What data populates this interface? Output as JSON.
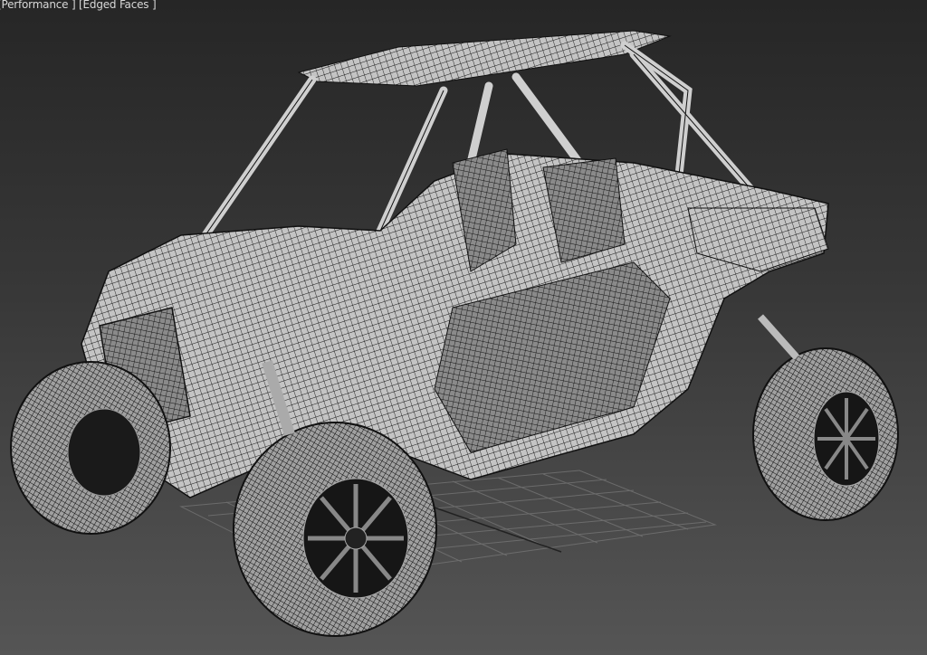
{
  "viewport": {
    "labels": {
      "shading_mode": "[Performance ]",
      "edged_faces": "[Edged Faces ]"
    },
    "colors": {
      "background_top": "#262626",
      "background_bottom": "#555555",
      "wire": "#0a0a0a",
      "surface": "#bdbdbd",
      "grid": "#777777"
    }
  }
}
